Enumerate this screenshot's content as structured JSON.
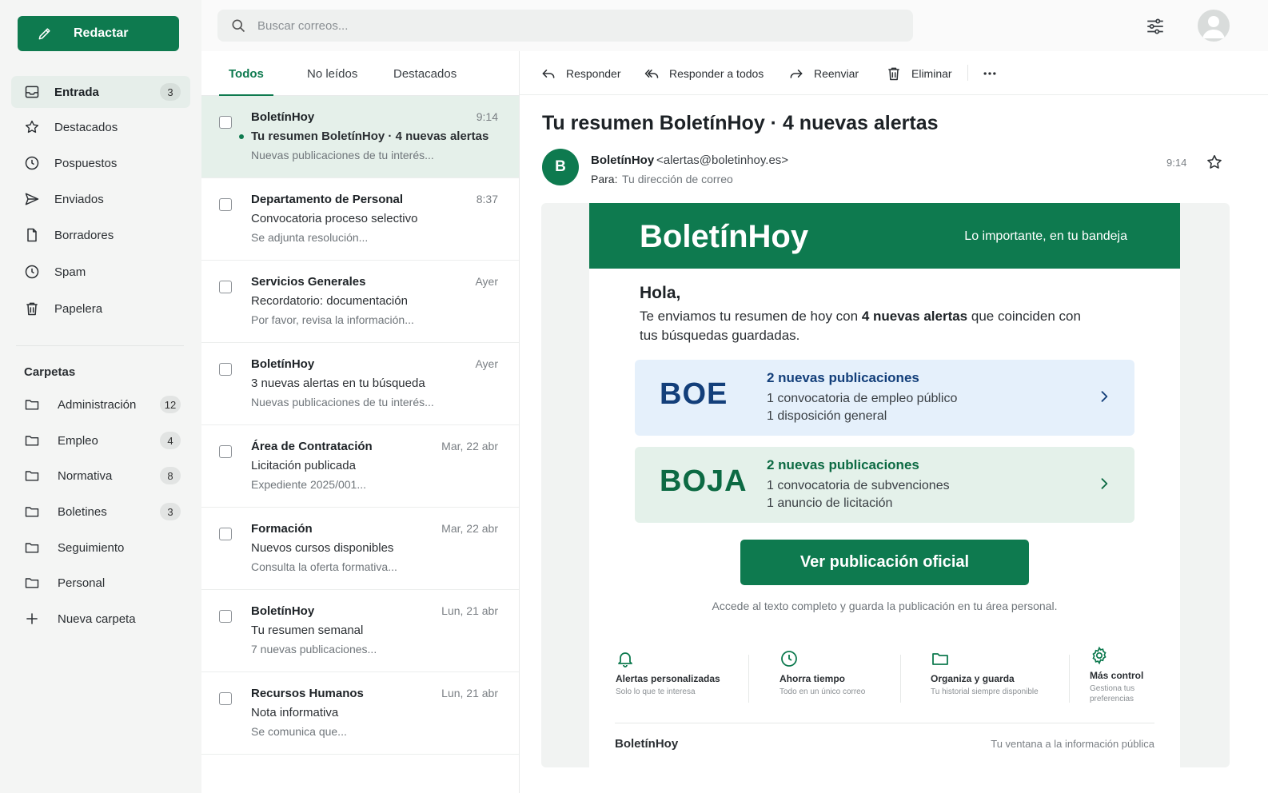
{
  "sidebar": {
    "compose_label": "Redactar",
    "nav": [
      {
        "label": "Entrada",
        "badge": "3"
      },
      {
        "label": "Destacados"
      },
      {
        "label": "Pospuestos"
      },
      {
        "label": "Enviados"
      },
      {
        "label": "Borradores"
      },
      {
        "label": "Spam"
      },
      {
        "label": "Papelera"
      }
    ],
    "folders_title": "Carpetas",
    "folders": [
      {
        "label": "Administración",
        "badge": "12"
      },
      {
        "label": "Empleo",
        "badge": "4"
      },
      {
        "label": "Normativa",
        "badge": "8"
      },
      {
        "label": "Boletines",
        "badge": "3"
      },
      {
        "label": "Seguimiento"
      },
      {
        "label": "Personal"
      }
    ],
    "new_folder_label": "Nueva carpeta"
  },
  "search": {
    "placeholder": "Buscar correos..."
  },
  "list": {
    "tabs": [
      "Todos",
      "No leídos",
      "Destacados"
    ],
    "items": [
      {
        "from": "BoletínHoy",
        "time": "9:14",
        "subject": "Tu resumen BoletínHoy · 4 nuevas alertas",
        "preview": "Nuevas publicaciones de tu interés..."
      },
      {
        "from": "Departamento de Personal",
        "time": "8:37",
        "subject": "Convocatoria proceso selectivo",
        "preview": "Se adjunta resolución..."
      },
      {
        "from": "Servicios Generales",
        "time": "Ayer",
        "subject": "Recordatorio: documentación",
        "preview": "Por favor, revisa la información..."
      },
      {
        "from": "BoletínHoy",
        "time": "Ayer",
        "subject": "3 nuevas alertas en tu búsqueda",
        "preview": "Nuevas publicaciones de tu interés..."
      },
      {
        "from": "Área de Contratación",
        "time": "Mar, 22 abr",
        "subject": "Licitación publicada",
        "preview": "Expediente 2025/001..."
      },
      {
        "from": "Formación",
        "time": "Mar, 22 abr",
        "subject": "Nuevos cursos disponibles",
        "preview": "Consulta la oferta formativa..."
      },
      {
        "from": "BoletínHoy",
        "time": "Lun, 21 abr",
        "subject": "Tu resumen semanal",
        "preview": "7 nuevas publicaciones..."
      },
      {
        "from": "Recursos Humanos",
        "time": "Lun, 21 abr",
        "subject": "Nota informativa",
        "preview": "Se comunica que..."
      }
    ]
  },
  "toolbar": {
    "reply": "Responder",
    "reply_all": "Responder a todos",
    "forward": "Reenviar",
    "delete": "Eliminar"
  },
  "mail": {
    "subject": "Tu resumen BoletínHoy · 4 nuevas alertas",
    "sender_initial": "B",
    "sender_name": "BoletínHoy",
    "sender_email": "<alertas@boletinhoy.es>",
    "to_label": "Para:",
    "to_value": "Tu dirección de correo",
    "time": "9:14"
  },
  "newsletter": {
    "brand": "BoletínHoy",
    "tagline": "Lo importante, en tu bandeja",
    "greeting": "Hola,",
    "intro_a": "Te enviamos tu resumen de hoy con ",
    "intro_b": "4 nuevas alertas",
    "intro_c": " que coinciden con tus búsquedas guardadas.",
    "sources": [
      {
        "logo": "BOE",
        "heading": "2 nuevas publicaciones",
        "line1": "1 convocatoria de empleo público",
        "line2": "1 disposición general"
      },
      {
        "logo": "BOJA",
        "heading": "2 nuevas publicaciones",
        "line1": "1 convocatoria de subvenciones",
        "line2": "1 anuncio de licitación"
      }
    ],
    "cta": "Ver publicación oficial",
    "cta_note": "Accede al texto completo y guarda la publicación en tu área personal.",
    "features": [
      {
        "title": "Alertas personalizadas",
        "sub": "Solo lo que te interesa"
      },
      {
        "title": "Ahorra tiempo",
        "sub": "Todo en un único correo"
      },
      {
        "title": "Organiza y guarda",
        "sub": "Tu historial siempre disponible"
      },
      {
        "title": "Más control",
        "sub": "Gestiona tus preferencias"
      }
    ],
    "footer_brand": "BoletínHoy",
    "footer_tagline": "Tu ventana a la información pública"
  },
  "colors": {
    "accent": "#0e7a4f",
    "boe": "#133f7a",
    "boja": "#0c6a43"
  }
}
